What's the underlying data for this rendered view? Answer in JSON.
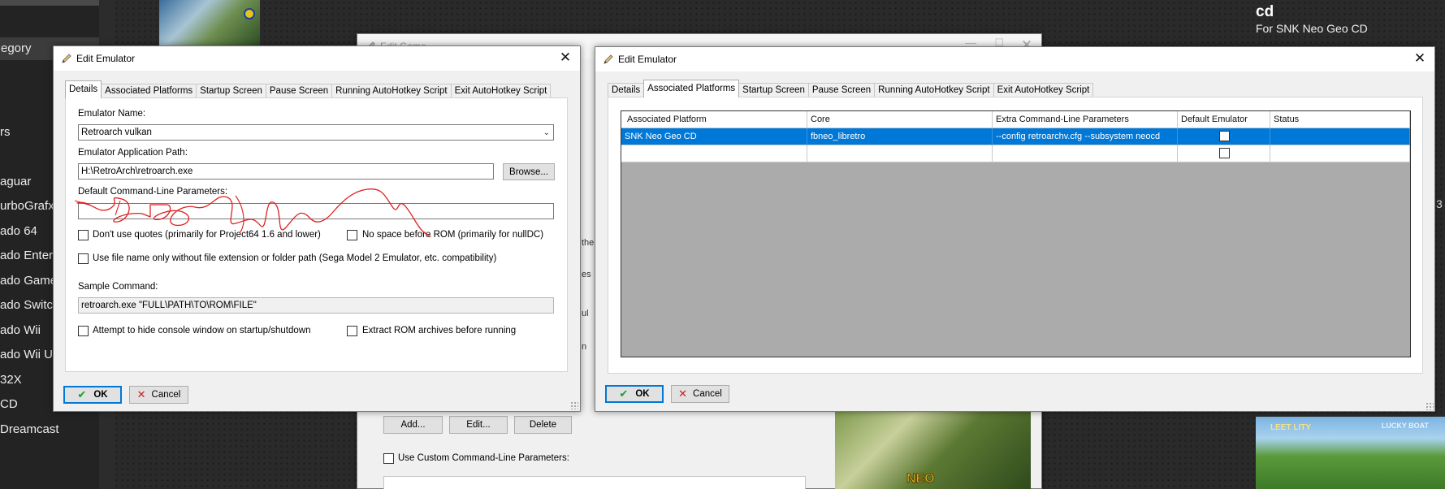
{
  "background": {
    "left_combo": "egory",
    "left_items": [
      "rs",
      "aguar",
      "urboGrafx-",
      "ado 64",
      "ado Enterta",
      "ado GameC",
      "ado Switch",
      "ado Wii",
      "ado Wii U",
      "32X",
      "CD",
      "Dreamcast"
    ],
    "right_title": "cd",
    "right_subtitle": "For SNK Neo Geo CD",
    "right_edge_text": "3",
    "bottom_thumb_t1": "LEET LITY",
    "bottom_thumb_t2": "LUCKY BOAT"
  },
  "edit_game": {
    "title": "Edit Game",
    "fragments": [
      "the",
      "es",
      "ul",
      "n"
    ],
    "buttons": {
      "add": "Add...",
      "edit": "Edit...",
      "delete": "Delete"
    },
    "custom_params_label": "Use Custom Command-Line Parameters:",
    "art_text": "NEO"
  },
  "left_dialog": {
    "title": "Edit Emulator",
    "tabs": [
      "Details",
      "Associated Platforms",
      "Startup Screen",
      "Pause Screen",
      "Running AutoHotkey Script",
      "Exit AutoHotkey Script"
    ],
    "active_tab": "Details",
    "emulator_name_label": "Emulator Name:",
    "emulator_name_value": "Retroarch vulkan",
    "app_path_label": "Emulator Application Path:",
    "app_path_value": "H:\\RetroArch\\retroarch.exe",
    "browse_label": "Browse...",
    "default_params_label": "Default Command-Line Parameters:",
    "default_params_value": "",
    "options": {
      "dont_use_quotes": "Don't use quotes (primarily for Project64 1.6 and lower)",
      "no_space_before_rom": "No space before ROM (primarily for nullDC)",
      "use_file_name_only": "Use file name only without file extension or folder path (Sega Model 2 Emulator, etc. compatibility)",
      "hide_console": "Attempt to hide console window on startup/shutdown",
      "extract_rom": "Extract ROM archives before running"
    },
    "sample_command_label": "Sample Command:",
    "sample_command_value": "retroarch.exe \"FULL\\PATH\\TO\\ROM\\FILE\"",
    "ok_label": "OK",
    "cancel_label": "Cancel"
  },
  "right_dialog": {
    "title": "Edit Emulator",
    "tabs": [
      "Details",
      "Associated Platforms",
      "Startup Screen",
      "Pause Screen",
      "Running AutoHotkey Script",
      "Exit AutoHotkey Script"
    ],
    "active_tab": "Associated Platforms",
    "columns": [
      "Associated Platform",
      "Core",
      "Extra Command-Line Parameters",
      "Default Emulator",
      "Status"
    ],
    "rows": [
      {
        "platform": "SNK Neo Geo CD",
        "core": "fbneo_libretro",
        "extra_params": "--config retroarchv.cfg --subsystem neocd",
        "default_emulator": false,
        "status": ""
      },
      {
        "platform": "",
        "core": "",
        "extra_params": "",
        "default_emulator": false,
        "status": ""
      }
    ],
    "ok_label": "OK",
    "cancel_label": "Cancel"
  },
  "colors": {
    "selection": "#0078d7",
    "ok_check": "#1a9e2f",
    "cancel_x": "#d11d1d",
    "scribble": "#e02020"
  },
  "icons": [
    "pencil-icon",
    "close-icon",
    "checkmark-icon",
    "cancel-x-icon",
    "chevron-down-icon"
  ]
}
